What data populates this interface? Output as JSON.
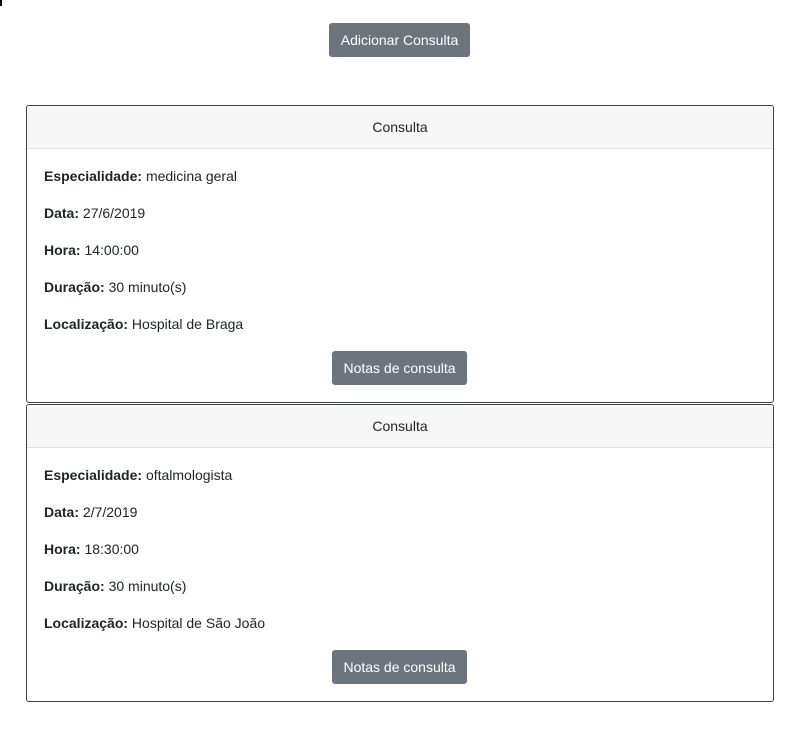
{
  "toolbar": {
    "add_label": "Adicionar Consulta"
  },
  "labels": {
    "especialidade": "Especialidade:",
    "data": "Data:",
    "hora": "Hora:",
    "duracao": "Duração:",
    "localizacao": "Localização:"
  },
  "consultas": [
    {
      "header": "Consulta",
      "especialidade": "medicina geral",
      "data": "27/6/2019",
      "hora": "14:00:00",
      "duracao": "30 minuto(s)",
      "localizacao": "Hospital de Braga",
      "notes_label": "Notas de consulta"
    },
    {
      "header": "Consulta",
      "especialidade": "oftalmologista",
      "data": "2/7/2019",
      "hora": "18:30:00",
      "duracao": "30 minuto(s)",
      "localizacao": "Hospital de São João",
      "notes_label": "Notas de consulta"
    }
  ],
  "colors": {
    "button_bg": "#6c757d",
    "header_bg": "#f7f7f7",
    "card_border": "#3e4246"
  }
}
